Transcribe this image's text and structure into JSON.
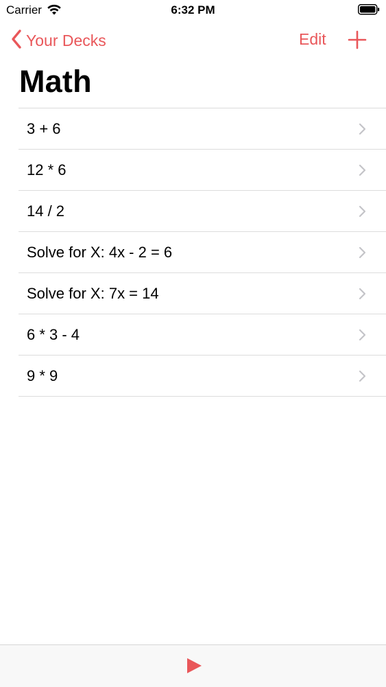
{
  "status_bar": {
    "carrier": "Carrier",
    "time": "6:32 PM"
  },
  "nav": {
    "back_label": "Your Decks",
    "edit_label": "Edit"
  },
  "title": "Math",
  "cards": [
    {
      "label": "3 + 6"
    },
    {
      "label": "12 * 6"
    },
    {
      "label": "14 / 2"
    },
    {
      "label": "Solve for X: 4x - 2 = 6"
    },
    {
      "label": "Solve for X: 7x = 14"
    },
    {
      "label": "6 * 3 - 4"
    },
    {
      "label": "9 * 9"
    }
  ],
  "icons": {
    "back": "chevron-left-icon",
    "add": "plus-icon",
    "row_disclosure": "chevron-right-icon",
    "play": "play-icon"
  },
  "colors": {
    "accent": "#e9575a",
    "separator": "#dcdcdc",
    "chevron": "#c4c4c8"
  }
}
